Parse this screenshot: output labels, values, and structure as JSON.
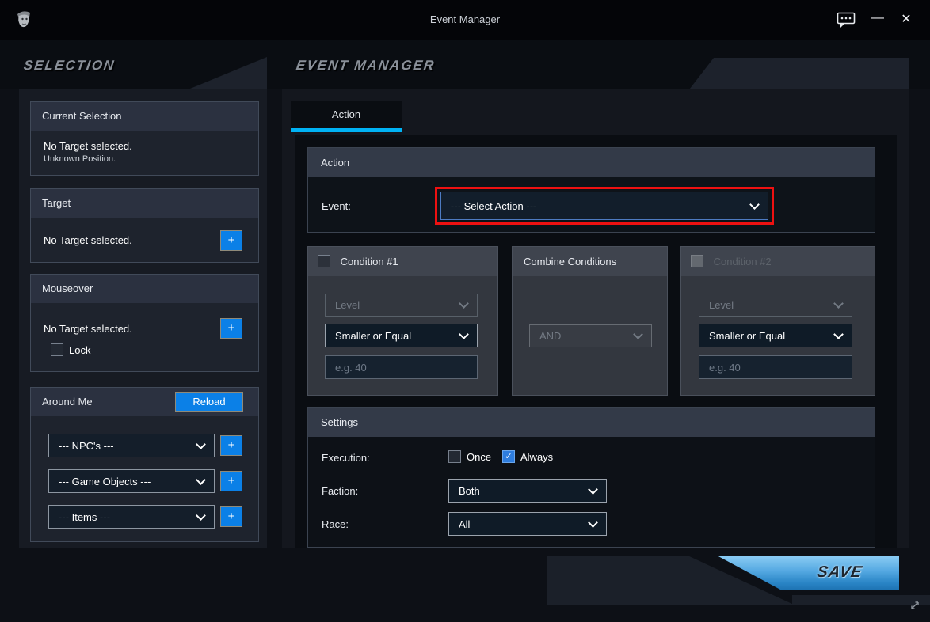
{
  "window": {
    "title": "Event Manager"
  },
  "icons": {
    "app": "wolf-face",
    "chat": "speech-bubble",
    "minimize": "—",
    "close": "✕",
    "plus": "+",
    "check": "✓",
    "chevron_down": "v",
    "resize": "⤡"
  },
  "colors": {
    "accent_blue": "#0b80e7",
    "tab_cyan": "#00b2f4",
    "highlight_red": "#ee1111",
    "save_gradient_top": "#8ccdf4",
    "save_gradient_bottom": "#1e74b4",
    "panel_dark": "#171b23",
    "section_header": "#2b3140"
  },
  "selection": {
    "title": "SELECTION",
    "current_selection": {
      "header": "Current Selection",
      "primary": "No Target selected.",
      "secondary": "Unknown Position."
    },
    "target": {
      "header": "Target",
      "empty": "No Target selected.",
      "add": "+"
    },
    "mouseover": {
      "header": "Mouseover",
      "empty": "No Target selected.",
      "add": "+",
      "lock": "Lock",
      "lock_checked": false
    },
    "around_me": {
      "header": "Around Me",
      "reload": "Reload",
      "add": "+",
      "dropdowns": [
        {
          "value": "--- NPC's ---"
        },
        {
          "value": "--- Game Objects ---"
        },
        {
          "value": "--- Items ---"
        }
      ]
    }
  },
  "event_manager": {
    "title": "EVENT MANAGER",
    "active_tab": "Action",
    "action": {
      "header": "Action",
      "event_label": "Event:",
      "event_value": "--- Select Action ---"
    },
    "condition1": {
      "header": "Condition #1",
      "checked": false,
      "field": "Level",
      "operator": "Smaller or Equal",
      "value_placeholder": "e.g. 40"
    },
    "combine": {
      "header": "Combine Conditions",
      "operator": "AND"
    },
    "condition2": {
      "header": "Condition #2",
      "checked": false,
      "field": "Level",
      "operator": "Smaller or Equal",
      "value_placeholder": "e.g. 40"
    },
    "settings": {
      "header": "Settings",
      "execution_label": "Execution:",
      "once": "Once",
      "once_checked": false,
      "always": "Always",
      "always_checked": true,
      "faction_label": "Faction:",
      "faction_value": "Both",
      "race_label": "Race:",
      "race_value": "All"
    },
    "save": "SAVE"
  }
}
